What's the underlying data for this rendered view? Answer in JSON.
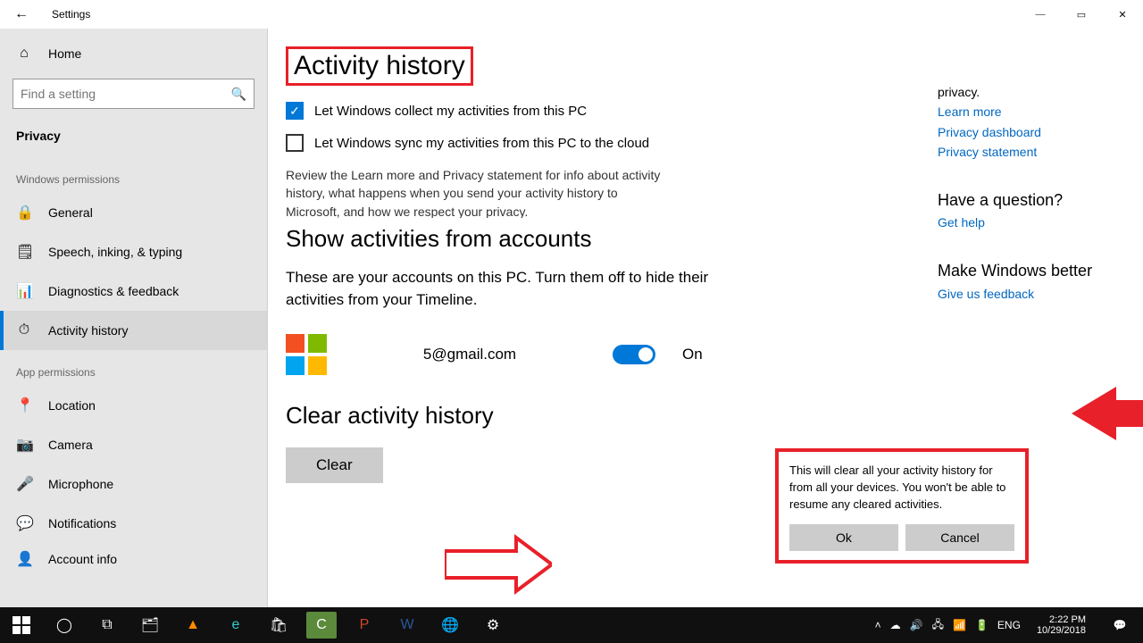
{
  "window": {
    "app_title": "Settings",
    "back_glyph": "←",
    "minimize_glyph": "—",
    "maximize_glyph": "▭",
    "close_glyph": "✕"
  },
  "sidebar": {
    "home": "Home",
    "search_placeholder": "Find a setting",
    "privacy_header": "Privacy",
    "section_windows": "Windows permissions",
    "items_win": [
      {
        "icon": "🔒",
        "label": "General"
      },
      {
        "icon": "🗒",
        "label": "Speech, inking, & typing"
      },
      {
        "icon": "📊",
        "label": "Diagnostics & feedback"
      },
      {
        "icon": "⏱",
        "label": "Activity history"
      }
    ],
    "section_app": "App permissions",
    "items_app": [
      {
        "icon": "📍",
        "label": "Location"
      },
      {
        "icon": "📷",
        "label": "Camera"
      },
      {
        "icon": "🎤",
        "label": "Microphone"
      },
      {
        "icon": "💬",
        "label": "Notifications"
      },
      {
        "icon": "👤",
        "label": "Account info"
      }
    ]
  },
  "main": {
    "title": "Activity history",
    "checkbox1": "Let Windows collect my activities from this PC",
    "checkbox2": "Let Windows sync my activities from this PC to the cloud",
    "review_text": "Review the Learn more and Privacy statement for info about activity history, what happens when you send your activity history to Microsoft, and how we respect your privacy.",
    "accounts_header": "Show activities from accounts",
    "accounts_desc": "These are your accounts on this PC. Turn them off to hide their activities from your Timeline.",
    "email": "5@gmail.com",
    "toggle_state": "On",
    "clear_header": "Clear activity history",
    "clear_button": "Clear"
  },
  "dialog": {
    "message": "This will clear all your activity history for from all your devices.  You won't be able to resume any cleared activities.",
    "ok": "Ok",
    "cancel": "Cancel"
  },
  "rightpane": {
    "privacy_word": "privacy.",
    "learn_more": "Learn more",
    "privacy_dashboard": "Privacy dashboard",
    "privacy_statement": "Privacy statement",
    "question_hdr": "Have a question?",
    "get_help": "Get help",
    "better_hdr": "Make Windows better",
    "feedback": "Give us feedback"
  },
  "taskbar": {
    "lang": "ENG",
    "time": "2:22 PM",
    "date": "10/29/2018"
  }
}
